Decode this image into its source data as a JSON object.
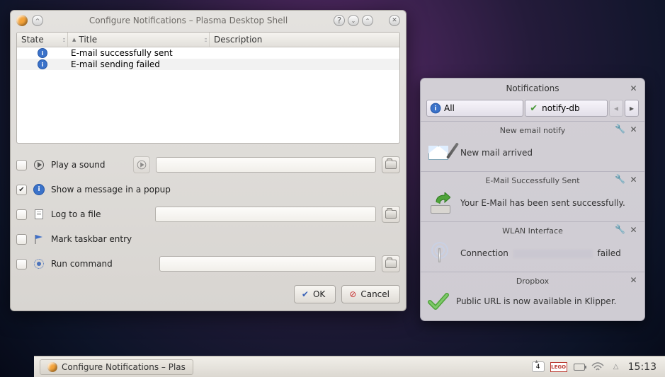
{
  "window": {
    "title": "Configure Notifications – Plasma Desktop Shell",
    "columns": {
      "state": "State",
      "title": "Title",
      "description": "Description"
    },
    "rows": [
      {
        "title": "E-mail successfully sent"
      },
      {
        "title": "E-mail sending failed"
      }
    ],
    "opts": {
      "sound": "Play a sound",
      "popup": "Show a message in a popup",
      "logfile": "Log to a file",
      "taskbar": "Mark taskbar entry",
      "runcmd": "Run command"
    },
    "buttons": {
      "ok": "OK",
      "cancel": "Cancel"
    }
  },
  "notifications": {
    "title": "Notifications",
    "filter_all": "All",
    "filter_source": "notify-db",
    "items": [
      {
        "head": "New email notify",
        "body": "New mail arrived",
        "wrench": true
      },
      {
        "head": "E-Mail Successfully Sent",
        "body": "Your E-Mail has been sent successfully.",
        "wrench": true
      },
      {
        "head": "WLAN Interface",
        "body_pre": "Connection ",
        "body_post": " failed",
        "wrench": true
      },
      {
        "head": "Dropbox",
        "body": "Public URL is now available in Klipper.",
        "wrench": false
      }
    ]
  },
  "taskbar": {
    "active": "Configure Notifications – Plas",
    "updates": "4",
    "lego": "LEGO",
    "clock": "15:13"
  }
}
